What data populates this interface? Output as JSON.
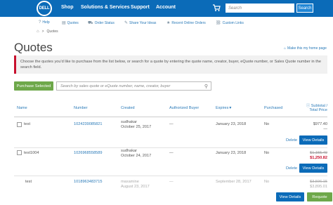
{
  "topnav": {
    "logo": "DELL",
    "links": [
      "Shop",
      "Solutions & Services",
      "Support",
      "Account"
    ],
    "search_placeholder": "Search",
    "search_button": "Search"
  },
  "toolbar": {
    "items": [
      {
        "label": "Help",
        "icon": "help-icon"
      },
      {
        "label": "Quotes",
        "icon": "quotes-icon"
      },
      {
        "label": "Order Status",
        "icon": "order-status-icon"
      },
      {
        "label": "Share Your Ideas",
        "icon": "share-ideas-icon"
      },
      {
        "label": "Recent Online Orders",
        "icon": "recent-orders-icon"
      },
      {
        "label": "Custom Links",
        "icon": "custom-links-icon"
      }
    ]
  },
  "breadcrumb": {
    "home_icon": "home-icon",
    "separator": ">",
    "current": "Quotes"
  },
  "page": {
    "title": "Quotes",
    "make_homepage": "Make this my home page",
    "notice": "Choose the quotes you'd like to purchase from the list below, or search for a quote by entering the quote name, creator, buyer, eQuote number, or Sales Quote number in the search field.",
    "purchase_button": "Purchase Selected",
    "search_placeholder": "Search by sales quote or eQuote number, name, creator, buyer"
  },
  "table": {
    "headers": {
      "name": "Name",
      "number": "Number",
      "created": "Created",
      "buyer": "Authorized Buyer",
      "expires": "Expires",
      "expires_sort": "▼",
      "purchased": "Purchased",
      "subtotal": "Subtotal /",
      "total": "Total Price"
    },
    "rows": [
      {
        "name": "test",
        "number": "1024239085821",
        "creator": "sudhakar",
        "created": "October 25, 2017",
        "buyer": "—",
        "expires": "January 23, 2018",
        "purchased": "No",
        "subtotal": "$977.40",
        "total": "—",
        "delete": "Delete",
        "view": "View Details"
      },
      {
        "name": "test1004",
        "number": "1026968558589",
        "creator": "sudhakar",
        "created": "October 24, 2017",
        "buyer": "—",
        "expires": "January 23, 2018",
        "purchased": "No",
        "subtotal": "$1,155.49",
        "total": "$1,250.82",
        "delete": "Delete",
        "view": "View Details"
      },
      {
        "name": "test",
        "number": "1018963483715",
        "creator": "maxamine",
        "created": "August 23, 2017",
        "buyer": "—",
        "expires": "September 28, 2017",
        "purchased": "No",
        "subtotal": "$3,596.15",
        "total": "$3,895.01",
        "view": "View Details",
        "requote": "Requote"
      }
    ]
  }
}
